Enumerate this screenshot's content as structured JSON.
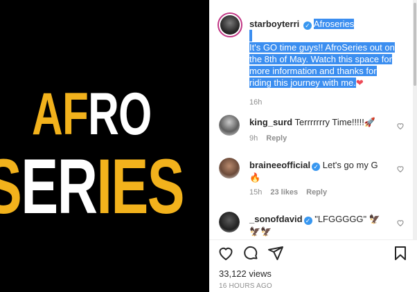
{
  "media": {
    "line1_a": "AF",
    "line1_b": "RO",
    "line2_a": "S",
    "line2_b": "ER",
    "line2_c": "IES"
  },
  "post": {
    "username": "starboyterri",
    "title": "Afroseries",
    "caption_line1": "It's GO time guys!! AfroSeries out on",
    "caption_line2": "the 8th of May. Watch this space for",
    "caption_line3": "more information and thanks for",
    "caption_line4": "riding this journey with me.",
    "caption_emoji": "❤",
    "time": "16h"
  },
  "comments": [
    {
      "username": "king_surd",
      "text": "Terrrrrrry Time!!!!!",
      "emoji": "🚀",
      "time": "9h",
      "reply": "Reply"
    },
    {
      "username": "braineeofficial",
      "text": "Let's go my G",
      "emoji": "🔥",
      "time": "15h",
      "likes": "23 likes",
      "reply": "Reply"
    },
    {
      "username": "_sonofdavid",
      "text": "\"LFGGGGG\"",
      "emoji": "🦅",
      "emoji2": "🦅🦅"
    }
  ],
  "stats": {
    "views": "33,122 views",
    "posted": "16 HOURS AGO"
  },
  "icons": [
    "heart-icon",
    "comment-icon",
    "share-icon",
    "bookmark-icon",
    "verified-icon"
  ],
  "colors": {
    "accent_yellow": "#f2b21c",
    "selection": "#3b8ef0",
    "verified": "#3897f0",
    "emoji_heart": "#ed4956"
  }
}
